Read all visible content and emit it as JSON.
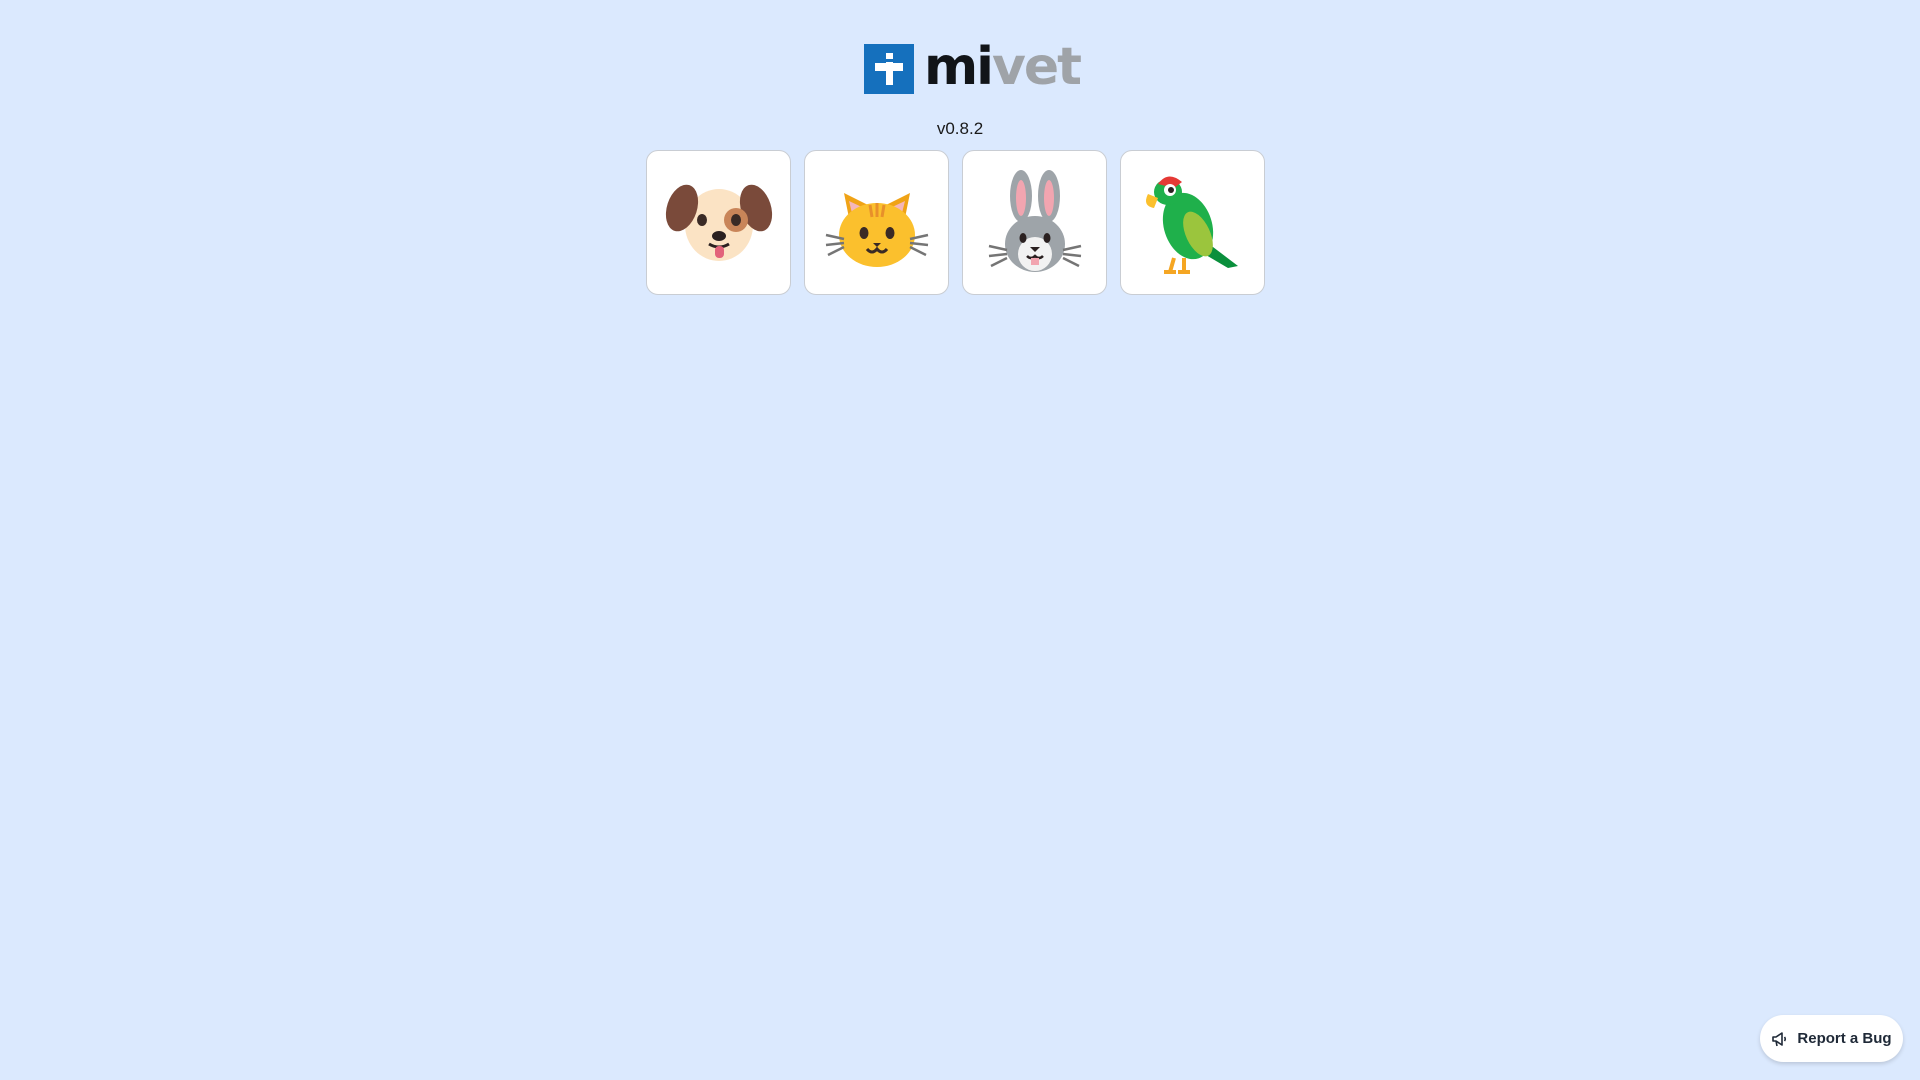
{
  "brand": {
    "name_part1": "mi",
    "name_part2": "vet",
    "mark_color": "#1570bd"
  },
  "version": "v0.8.2",
  "animals": [
    {
      "name": "dog",
      "icon": "dog-face-icon"
    },
    {
      "name": "cat",
      "icon": "cat-face-icon"
    },
    {
      "name": "rabbit",
      "icon": "rabbit-face-icon"
    },
    {
      "name": "parrot",
      "icon": "parrot-icon"
    }
  ],
  "report_bug": {
    "label": "Report a Bug",
    "icon": "megaphone-icon"
  },
  "colors": {
    "background": "#dbe9fe",
    "accent": "#1570bd"
  }
}
